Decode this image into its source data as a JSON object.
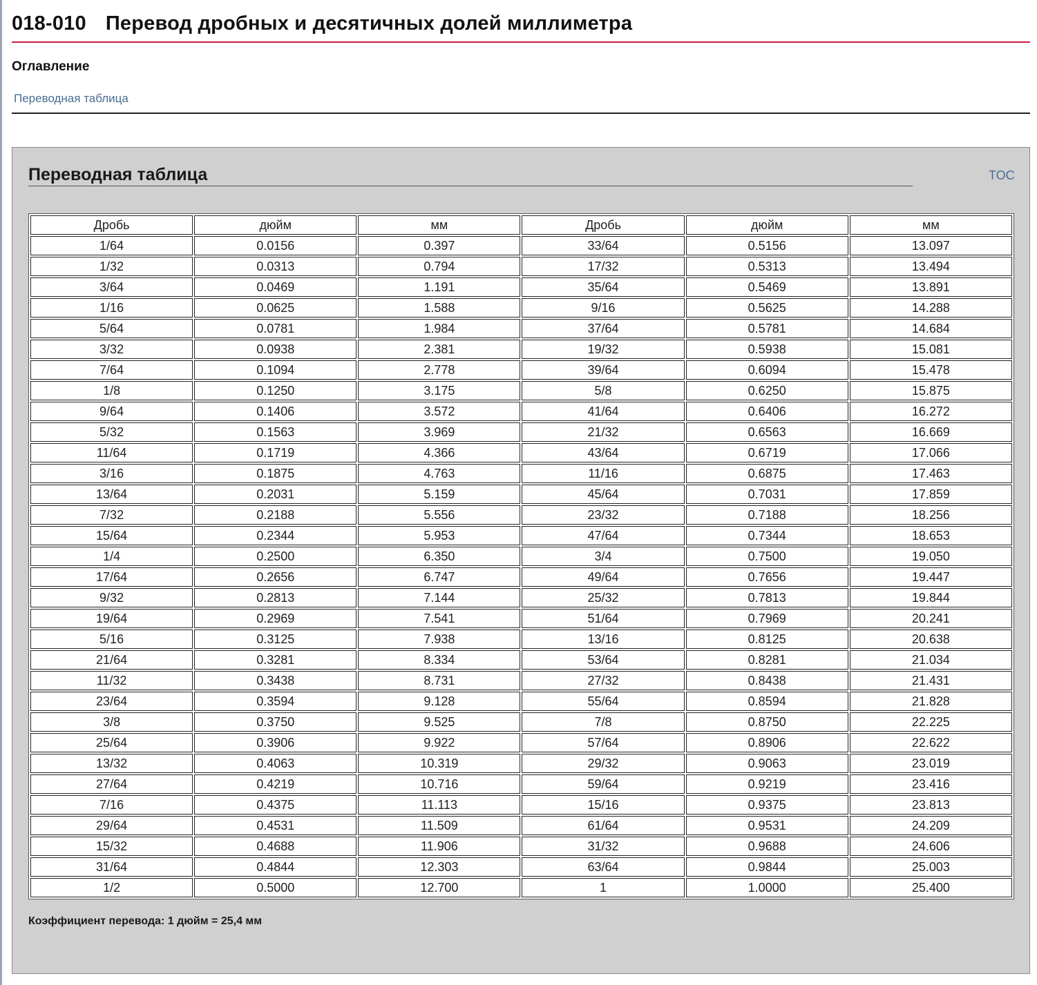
{
  "header": {
    "doc_id": "018-010",
    "title": "Перевод дробных и десятичных долей миллиметра"
  },
  "toc": {
    "heading": "Оглавление",
    "items": [
      {
        "label": "Переводная таблица"
      }
    ]
  },
  "section": {
    "title": "Переводная таблица",
    "toc_link": "TOC",
    "footnote": "Коэффициент перевода: 1 дюйм = 25,4 мм"
  },
  "table": {
    "columns": [
      "Дробь",
      "дюйм",
      "мм",
      "Дробь",
      "дюйм",
      "мм"
    ],
    "rows": [
      [
        "1/64",
        "0.0156",
        "0.397",
        "33/64",
        "0.5156",
        "13.097"
      ],
      [
        "1/32",
        "0.0313",
        "0.794",
        "17/32",
        "0.5313",
        "13.494"
      ],
      [
        "3/64",
        "0.0469",
        "1.191",
        "35/64",
        "0.5469",
        "13.891"
      ],
      [
        "1/16",
        "0.0625",
        "1.588",
        "9/16",
        "0.5625",
        "14.288"
      ],
      [
        "5/64",
        "0.0781",
        "1.984",
        "37/64",
        "0.5781",
        "14.684"
      ],
      [
        "3/32",
        "0.0938",
        "2.381",
        "19/32",
        "0.5938",
        "15.081"
      ],
      [
        "7/64",
        "0.1094",
        "2.778",
        "39/64",
        "0.6094",
        "15.478"
      ],
      [
        "1/8",
        "0.1250",
        "3.175",
        "5/8",
        "0.6250",
        "15.875"
      ],
      [
        "9/64",
        "0.1406",
        "3.572",
        "41/64",
        "0.6406",
        "16.272"
      ],
      [
        "5/32",
        "0.1563",
        "3.969",
        "21/32",
        "0.6563",
        "16.669"
      ],
      [
        "11/64",
        "0.1719",
        "4.366",
        "43/64",
        "0.6719",
        "17.066"
      ],
      [
        "3/16",
        "0.1875",
        "4.763",
        "11/16",
        "0.6875",
        "17.463"
      ],
      [
        "13/64",
        "0.2031",
        "5.159",
        "45/64",
        "0.7031",
        "17.859"
      ],
      [
        "7/32",
        "0.2188",
        "5.556",
        "23/32",
        "0.7188",
        "18.256"
      ],
      [
        "15/64",
        "0.2344",
        "5.953",
        "47/64",
        "0.7344",
        "18.653"
      ],
      [
        "1/4",
        "0.2500",
        "6.350",
        "3/4",
        "0.7500",
        "19.050"
      ],
      [
        "17/64",
        "0.2656",
        "6.747",
        "49/64",
        "0.7656",
        "19.447"
      ],
      [
        "9/32",
        "0.2813",
        "7.144",
        "25/32",
        "0.7813",
        "19.844"
      ],
      [
        "19/64",
        "0.2969",
        "7.541",
        "51/64",
        "0.7969",
        "20.241"
      ],
      [
        "5/16",
        "0.3125",
        "7.938",
        "13/16",
        "0.8125",
        "20.638"
      ],
      [
        "21/64",
        "0.3281",
        "8.334",
        "53/64",
        "0.8281",
        "21.034"
      ],
      [
        "11/32",
        "0.3438",
        "8.731",
        "27/32",
        "0.8438",
        "21.431"
      ],
      [
        "23/64",
        "0.3594",
        "9.128",
        "55/64",
        "0.8594",
        "21.828"
      ],
      [
        "3/8",
        "0.3750",
        "9.525",
        "7/8",
        "0.8750",
        "22.225"
      ],
      [
        "25/64",
        "0.3906",
        "9.922",
        "57/64",
        "0.8906",
        "22.622"
      ],
      [
        "13/32",
        "0.4063",
        "10.319",
        "29/32",
        "0.9063",
        "23.019"
      ],
      [
        "27/64",
        "0.4219",
        "10.716",
        "59/64",
        "0.9219",
        "23.416"
      ],
      [
        "7/16",
        "0.4375",
        "11.113",
        "15/16",
        "0.9375",
        "23.813"
      ],
      [
        "29/64",
        "0.4531",
        "11.509",
        "61/64",
        "0.9531",
        "24.209"
      ],
      [
        "15/32",
        "0.4688",
        "11.906",
        "31/32",
        "0.9688",
        "24.606"
      ],
      [
        "31/64",
        "0.4844",
        "12.303",
        "63/64",
        "0.9844",
        "25.003"
      ],
      [
        "1/2",
        "0.5000",
        "12.700",
        "1",
        "1.0000",
        "25.400"
      ]
    ]
  },
  "colors": {
    "title_underline": "#c8203a",
    "link": "#4a6d93",
    "panel_background": "#d0d0d0"
  }
}
